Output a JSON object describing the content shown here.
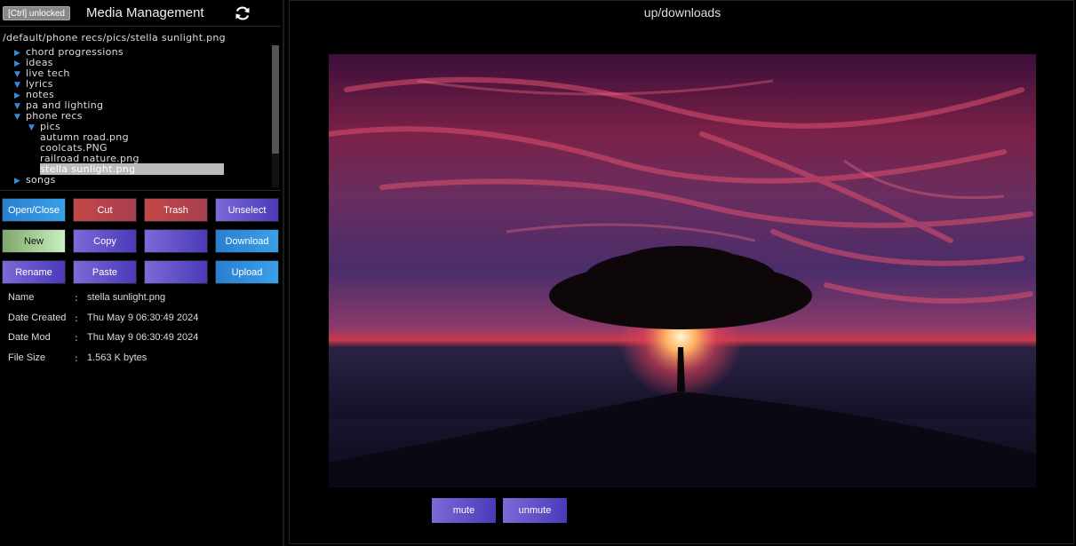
{
  "header": {
    "lock_label": "[Ctrl] unlocked",
    "title": "Media Management",
    "refresh_icon": "refresh-icon"
  },
  "current_path": "/default/phone recs/pics/stella sunlight.png",
  "tree": [
    {
      "label": "chord progressions",
      "expanded": false,
      "depth": 0
    },
    {
      "label": "ideas",
      "expanded": false,
      "depth": 0
    },
    {
      "label": "live tech",
      "expanded": true,
      "depth": 0
    },
    {
      "label": "lyrics",
      "expanded": true,
      "depth": 0
    },
    {
      "label": "notes",
      "expanded": false,
      "depth": 0
    },
    {
      "label": "pa and lighting",
      "expanded": true,
      "depth": 0
    },
    {
      "label": "phone recs",
      "expanded": true,
      "depth": 0
    },
    {
      "label": "pics",
      "expanded": true,
      "depth": 1
    },
    {
      "label": "autumn road.png",
      "depth": 2
    },
    {
      "label": "coolcats.PNG",
      "depth": 2
    },
    {
      "label": "railroad nature.png",
      "depth": 2
    },
    {
      "label": "stella sunlight.png",
      "depth": 2,
      "selected": true
    },
    {
      "label": "songs",
      "expanded": false,
      "depth": 0
    }
  ],
  "buttons": {
    "open_close": "Open/Close",
    "cut": "Cut",
    "trash": "Trash",
    "unselect": "Unselect",
    "new": "New",
    "copy": "Copy",
    "blank1": "",
    "download": "Download",
    "rename": "Rename",
    "paste": "Paste",
    "blank2": "",
    "upload": "Upload"
  },
  "info": {
    "name_label": "Name",
    "name_value": "stella sunlight.png",
    "created_label": "Date Created",
    "created_value": "Thu May 9 06:30:49 2024",
    "mod_label": "Date Mod",
    "mod_value": "Thu May 9 06:30:49 2024",
    "size_label": "File Size",
    "size_value": "1.563 K bytes",
    "colon": ":"
  },
  "viewer": {
    "title": "up/downloads",
    "mute": "mute",
    "unmute": "unmute"
  }
}
